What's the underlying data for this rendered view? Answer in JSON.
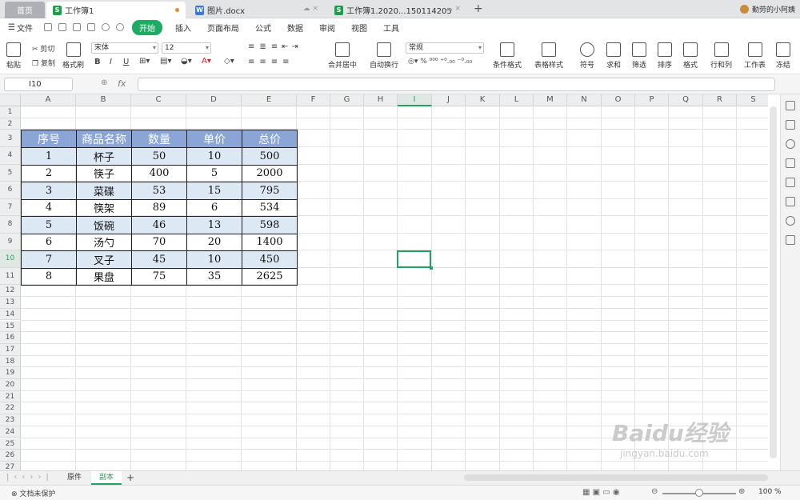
{
  "tabs": {
    "home": "首页",
    "active": "工作簿1",
    "doc": "图片.docx",
    "book2": "工作簿1.2020...150114205",
    "user": "勤劳的小阿姨"
  },
  "menu": {
    "file": "文件",
    "start": "开始",
    "items": [
      "插入",
      "页面布局",
      "公式",
      "数据",
      "审阅",
      "视图",
      "工具"
    ]
  },
  "ribbon": {
    "paste": "粘贴",
    "cut": "剪切",
    "copy": "复制",
    "format_painter": "格式刷",
    "font": "宋体",
    "size": "12",
    "merge": "合并居中",
    "wrap": "自动换行",
    "numfmt": "常规",
    "cond_format": "条件格式",
    "table_style": "表格样式",
    "symbol": "符号",
    "sum": "求和",
    "filter": "筛选",
    "sort": "排序",
    "format": "格式",
    "rowcol": "行和列",
    "worksheet": "工作表",
    "freeze": "冻结"
  },
  "formula": {
    "cell_ref": "I10",
    "fx": "fx",
    "value": ""
  },
  "columns": [
    "A",
    "B",
    "C",
    "D",
    "E",
    "F",
    "G",
    "H",
    "I",
    "J",
    "K",
    "L",
    "M",
    "N",
    "O",
    "P",
    "Q",
    "R",
    "S"
  ],
  "rows": [
    "1",
    "2",
    "3",
    "4",
    "5",
    "6",
    "7",
    "8",
    "9",
    "10",
    "11",
    "12",
    "13",
    "14",
    "15",
    "16",
    "17",
    "18",
    "19",
    "20",
    "21",
    "22",
    "23",
    "24",
    "25",
    "26",
    "27"
  ],
  "table": {
    "headers": [
      "序号",
      "商品名称",
      "数量",
      "单价",
      "总价"
    ],
    "rows": [
      [
        "1",
        "杯子",
        "50",
        "10",
        "500"
      ],
      [
        "2",
        "筷子",
        "400",
        "5",
        "2000"
      ],
      [
        "3",
        "菜碟",
        "53",
        "15",
        "795"
      ],
      [
        "4",
        "筷架",
        "89",
        "6",
        "534"
      ],
      [
        "5",
        "饭碗",
        "46",
        "13",
        "598"
      ],
      [
        "6",
        "汤勺",
        "70",
        "20",
        "1400"
      ],
      [
        "7",
        "叉子",
        "45",
        "10",
        "450"
      ],
      [
        "8",
        "果盘",
        "75",
        "35",
        "2625"
      ]
    ]
  },
  "sheets": [
    "原件",
    "副本"
  ],
  "status": {
    "protect": "文档未保护",
    "zoom": "100 %"
  },
  "watermark": {
    "brand": "Baidu经验",
    "url": "jingyan.baidu.com"
  }
}
